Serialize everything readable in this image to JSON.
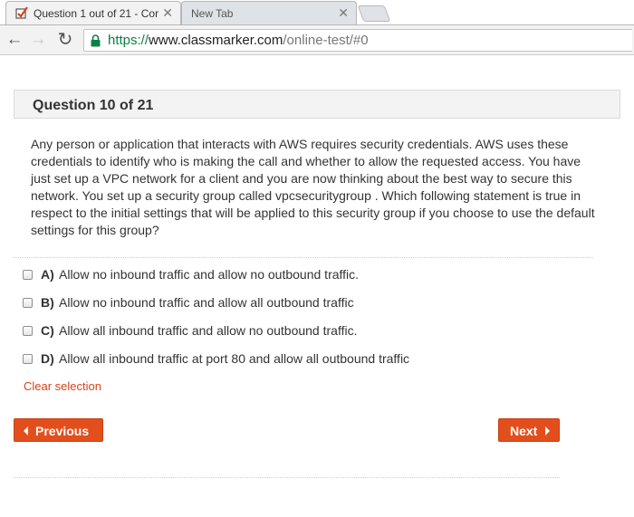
{
  "browser": {
    "tabs": [
      {
        "title": "Question 1 out of 21 - Cor",
        "icon": "checkbox-checkmark-icon",
        "active": true
      },
      {
        "title": "New Tab",
        "active": false
      }
    ],
    "address": {
      "scheme": "https://",
      "host": "www.classmarker.com",
      "path": "/online-test/#0"
    },
    "colors": {
      "secure_green": "#0b8043"
    }
  },
  "quiz": {
    "header": "Question 10 of 21",
    "question": "Any person or application that interacts with AWS requires security credentials. AWS uses these credentials to identify who is making the call and whether to allow the requested access. You have just set up a VPC network for a client and you are now thinking about the best way to secure this network. You set up a security group called vpcsecuritygroup . Which following statement is true in respect to the initial settings that will be applied to this security group if you choose to use the default settings for this group?",
    "options": [
      {
        "letter": "A)",
        "text": "Allow no inbound traffic and allow no outbound traffic.",
        "checked": false
      },
      {
        "letter": "B)",
        "text": "Allow no inbound traffic and allow all outbound traffic",
        "checked": false
      },
      {
        "letter": "C)",
        "text": "Allow all inbound traffic and allow no outbound traffic.",
        "checked": false
      },
      {
        "letter": "D)",
        "text": "Allow all inbound traffic at port 80 and allow all outbound traffic",
        "checked": false
      }
    ],
    "clear_label": "Clear selection",
    "prev_label": "Previous",
    "next_label": "Next",
    "colors": {
      "accent": "#e24f1d",
      "link": "#d5441c"
    }
  }
}
